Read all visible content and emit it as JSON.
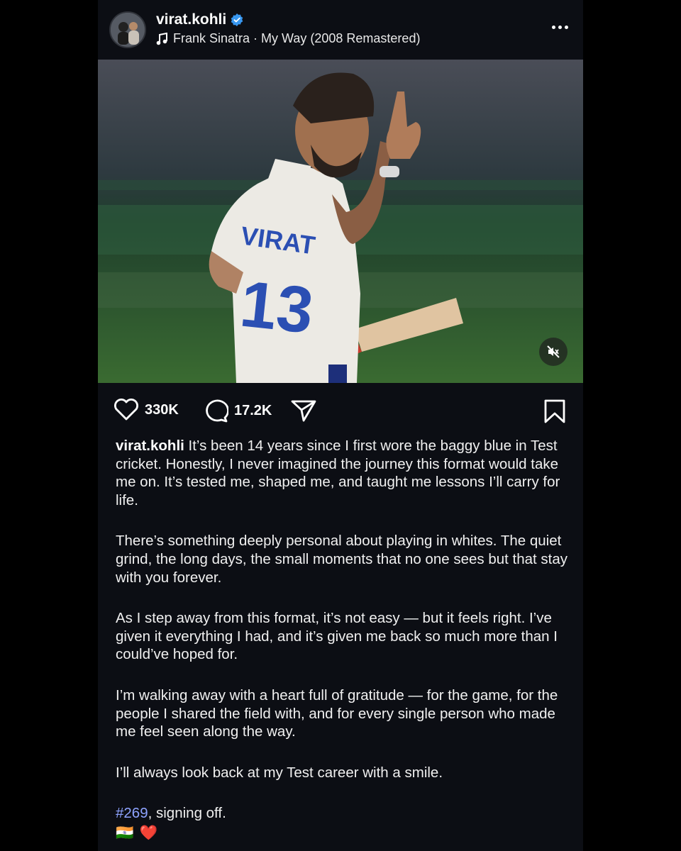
{
  "post": {
    "username": "virat.kohli",
    "song": "Frank Sinatra · My Way (2008 Remastered)",
    "likes": "330K",
    "comments": "17.2K",
    "jersey_name": "VIRAT",
    "jersey_number": "13"
  },
  "caption": {
    "username": "virat.kohli",
    "para1": " It’s been 14 years since I first wore the baggy blue in Test cricket. Honestly, I never imagined the journey this format would take me on. It’s tested me, shaped me, and taught me lessons I’ll carry for life.",
    "para2": "There’s something deeply personal about playing in whites. The quiet grind, the long days, the small moments that no one sees but that stay with you forever.",
    "para3": "As I step away from this format, it’s not easy — but it feels right. I’ve given it everything I had, and it’s given me back so much more than I could’ve hoped for.",
    "para4": "I’m walking away with a heart full of gratitude — for the game, for the people I shared the field with, and for every single person who made me feel seen along the way.",
    "para5": "I’ll always look back at my Test career with a smile.",
    "hashtag": "#269",
    "signoff": ", signing off.",
    "emoji_flag": "🇮🇳",
    "emoji_heart": "❤️"
  },
  "icons": {
    "verified": "verified-badge-icon",
    "music": "music-note-icon",
    "more": "more-options-icon",
    "mute": "muted-speaker-icon",
    "like": "heart-icon",
    "comment": "comment-bubble-icon",
    "share": "paper-plane-icon",
    "save": "bookmark-icon"
  },
  "colors": {
    "background": "#000000",
    "card": "#0c0e14",
    "verified": "#3897f0",
    "hashtag": "#8ea3ff"
  }
}
